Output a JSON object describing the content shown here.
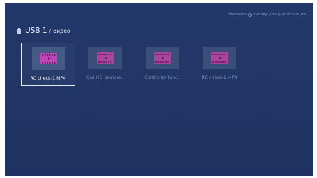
{
  "hint": {
    "prefix": "Нажмите",
    "suffix": "кнопку для других опций",
    "icon": "menu-button-icon"
  },
  "breadcrumb": {
    "device": "USB 1",
    "separator": "/",
    "folder": "Видео",
    "icon": "usb-drive-icon"
  },
  "files": [
    {
      "name": "RC check-1.MP4",
      "focused": true,
      "icon": "video-file-icon"
    },
    {
      "name": "Kivi HD demore..",
      "focused": false,
      "icon": "video-file-icon"
    },
    {
      "name": "Controller func..",
      "focused": false,
      "icon": "video-file-icon"
    },
    {
      "name": "RC check-2.MP4",
      "focused": false,
      "icon": "video-file-icon"
    }
  ],
  "colors": {
    "background": "#23386a",
    "film_accent": "#c044b8",
    "focus_border": "#e4e9f4"
  }
}
